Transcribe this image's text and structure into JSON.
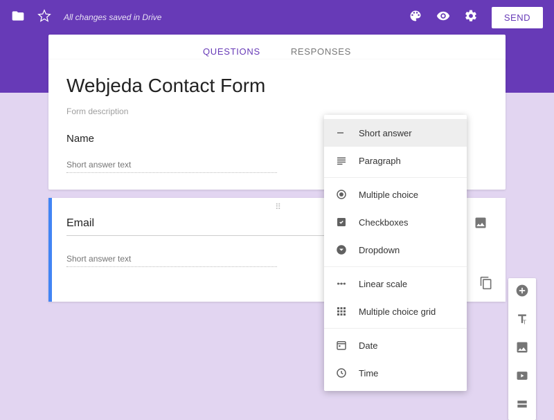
{
  "topbar": {
    "status": "All changes saved in Drive",
    "send": "SEND"
  },
  "tabs": {
    "questions": "QUESTIONS",
    "responses": "RESPONSES"
  },
  "form": {
    "title": "Webjeda Contact Form",
    "description": "Form description"
  },
  "q1": {
    "label": "Name",
    "placeholder": "Short answer text"
  },
  "q2": {
    "label": "Email",
    "placeholder": "Short answer text"
  },
  "dropdown": {
    "short_answer": "Short answer",
    "paragraph": "Paragraph",
    "multiple_choice": "Multiple choice",
    "checkboxes": "Checkboxes",
    "dropdown": "Dropdown",
    "linear_scale": "Linear scale",
    "multiple_choice_grid": "Multiple choice grid",
    "date": "Date",
    "time": "Time"
  }
}
